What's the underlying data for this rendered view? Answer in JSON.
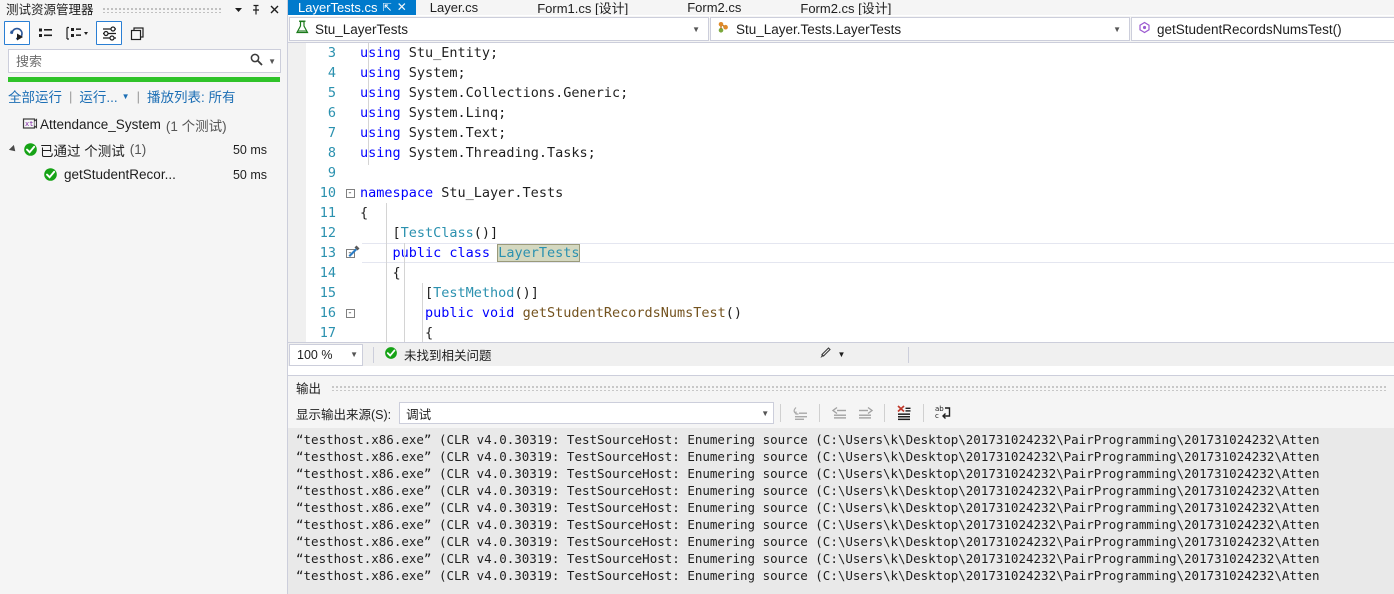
{
  "test_explorer": {
    "title": "测试资源管理器",
    "titlebar_buttons": [
      {
        "name": "window-dropdown-icon",
        "glyph": "▼"
      },
      {
        "name": "pin-icon",
        "glyph": "⇱"
      },
      {
        "name": "close-icon",
        "glyph": "✕"
      }
    ],
    "toolbar": [
      {
        "name": "run-all-tests-icon",
        "title": "运行所有测试"
      },
      {
        "name": "list-view-icon",
        "title": "列表视图"
      },
      {
        "name": "group-by-icon",
        "title": "分组依据"
      },
      {
        "name": "settings-icon",
        "title": "设置"
      },
      {
        "name": "copy-window-icon",
        "title": "窗口"
      }
    ],
    "search": {
      "placeholder": "搜索",
      "value": ""
    },
    "links": {
      "run_all": "全部运行",
      "run": "运行...",
      "playlist": "播放列表: 所有"
    },
    "tree": [
      {
        "label": "Attendance_System",
        "suffix": "(1 个测试)",
        "duration": "",
        "icon": "project-icon",
        "level": 0
      },
      {
        "label": "已通过 个测试",
        "suffix": "(1)",
        "duration": "50 ms",
        "icon": "passed-icon",
        "level": 0,
        "expanded": true
      },
      {
        "label": "getStudentRecor...",
        "suffix": "",
        "duration": "50 ms",
        "icon": "passed-icon",
        "level": 1
      }
    ]
  },
  "tabs": [
    {
      "label": "LayerTests.cs",
      "active": true,
      "pinned": true,
      "closable": true
    },
    {
      "label": "Layer.cs",
      "active": false
    },
    {
      "label": "Form1.cs [设计]",
      "active": false
    },
    {
      "label": "Form2.cs",
      "active": false
    },
    {
      "label": "Form2.cs [设计]",
      "active": false
    }
  ],
  "navbar": {
    "project": "Stu_LayerTests",
    "project_icon": "test-class-icon",
    "type": "Stu_Layer.Tests.LayerTests",
    "type_icon": "class-icon",
    "member": "getStudentRecordsNumsTest()",
    "member_icon": "method-icon",
    "caret": "▾"
  },
  "editor": {
    "lines": [
      {
        "num": "3",
        "fold": "",
        "tokens": [
          {
            "t": "using ",
            "c": "k"
          },
          {
            "t": "Stu_Entity;",
            "c": "n"
          }
        ],
        "indent": 2
      },
      {
        "num": "4",
        "fold": "",
        "tokens": [
          {
            "t": "using ",
            "c": "k"
          },
          {
            "t": "System;",
            "c": "n"
          }
        ],
        "indent": 2
      },
      {
        "num": "5",
        "fold": "",
        "tokens": [
          {
            "t": "using ",
            "c": "k"
          },
          {
            "t": "System.Collections.Generic;",
            "c": "n"
          }
        ],
        "indent": 2
      },
      {
        "num": "6",
        "fold": "",
        "tokens": [
          {
            "t": "using ",
            "c": "k"
          },
          {
            "t": "System.Linq;",
            "c": "n"
          }
        ],
        "indent": 2
      },
      {
        "num": "7",
        "fold": "",
        "tokens": [
          {
            "t": "using ",
            "c": "k"
          },
          {
            "t": "System.Text;",
            "c": "n"
          }
        ],
        "indent": 2
      },
      {
        "num": "8",
        "fold": "",
        "tokens": [
          {
            "t": "using ",
            "c": "k"
          },
          {
            "t": "System.Threading.Tasks;",
            "c": "n"
          }
        ],
        "indent": 2
      },
      {
        "num": "9",
        "fold": "",
        "tokens": [],
        "indent": 2
      },
      {
        "num": "10",
        "fold": "-",
        "tokens": [
          {
            "t": "namespace ",
            "c": "k"
          },
          {
            "t": "Stu_Layer.Tests",
            "c": "n"
          }
        ],
        "indent": 0
      },
      {
        "num": "11",
        "fold": "",
        "tokens": [
          {
            "t": "{",
            "c": "n"
          }
        ],
        "indent": 1
      },
      {
        "num": "12",
        "fold": "",
        "tokens": [
          {
            "t": "    [",
            "c": "n"
          },
          {
            "t": "TestClass",
            "c": "t"
          },
          {
            "t": "()]",
            "c": "n"
          }
        ],
        "indent": 1
      },
      {
        "num": "13",
        "fold": "-",
        "gutter": "quick-actions-icon",
        "highlight": true,
        "tokens": [
          {
            "t": "    ",
            "c": "n"
          },
          {
            "t": "public class ",
            "c": "k"
          },
          {
            "t": "LayerTests",
            "c": "t sel"
          }
        ],
        "indent": 1
      },
      {
        "num": "14",
        "fold": "",
        "tokens": [
          {
            "t": "    {",
            "c": "n"
          }
        ],
        "indent": 1
      },
      {
        "num": "15",
        "fold": "",
        "tokens": [
          {
            "t": "        [",
            "c": "n"
          },
          {
            "t": "TestMethod",
            "c": "t"
          },
          {
            "t": "()]",
            "c": "n"
          }
        ],
        "indent": 1
      },
      {
        "num": "16",
        "fold": "-",
        "tokens": [
          {
            "t": "        ",
            "c": "n"
          },
          {
            "t": "public void ",
            "c": "k"
          },
          {
            "t": "getStudentRecordsNumsTest",
            "c": "m"
          },
          {
            "t": "()",
            "c": "n"
          }
        ],
        "indent": 1
      },
      {
        "num": "17",
        "fold": "",
        "tokens": [
          {
            "t": "        {",
            "c": "n"
          }
        ],
        "indent": 1
      }
    ]
  },
  "editor_status": {
    "zoom": "100 %",
    "caret": "▾",
    "issues_text": "未找到相关问题",
    "issues_icon": "check-circle-icon",
    "brush_icon": "brush-icon",
    "brush_caret": "▾"
  },
  "output": {
    "title": "输出",
    "source_label": "显示输出来源(S):",
    "source_value": "调试",
    "source_caret": "▾",
    "toolbar": [
      {
        "name": "find-message-in-code-icon",
        "disabled": true
      },
      {
        "name": "go-to-previous-message-icon",
        "disabled": true
      },
      {
        "name": "go-to-next-message-icon",
        "disabled": true
      },
      {
        "name": "clear-all-icon",
        "disabled": false
      },
      {
        "name": "toggle-word-wrap-icon",
        "disabled": false
      }
    ],
    "log_line": "“testhost.x86.exe” (CLR v4.0.30319: TestSourceHost: Enumering source (C:\\Users\\k\\Desktop\\201731024232\\PairProgramming\\201731024232\\Atten",
    "log_line_count": 9
  }
}
